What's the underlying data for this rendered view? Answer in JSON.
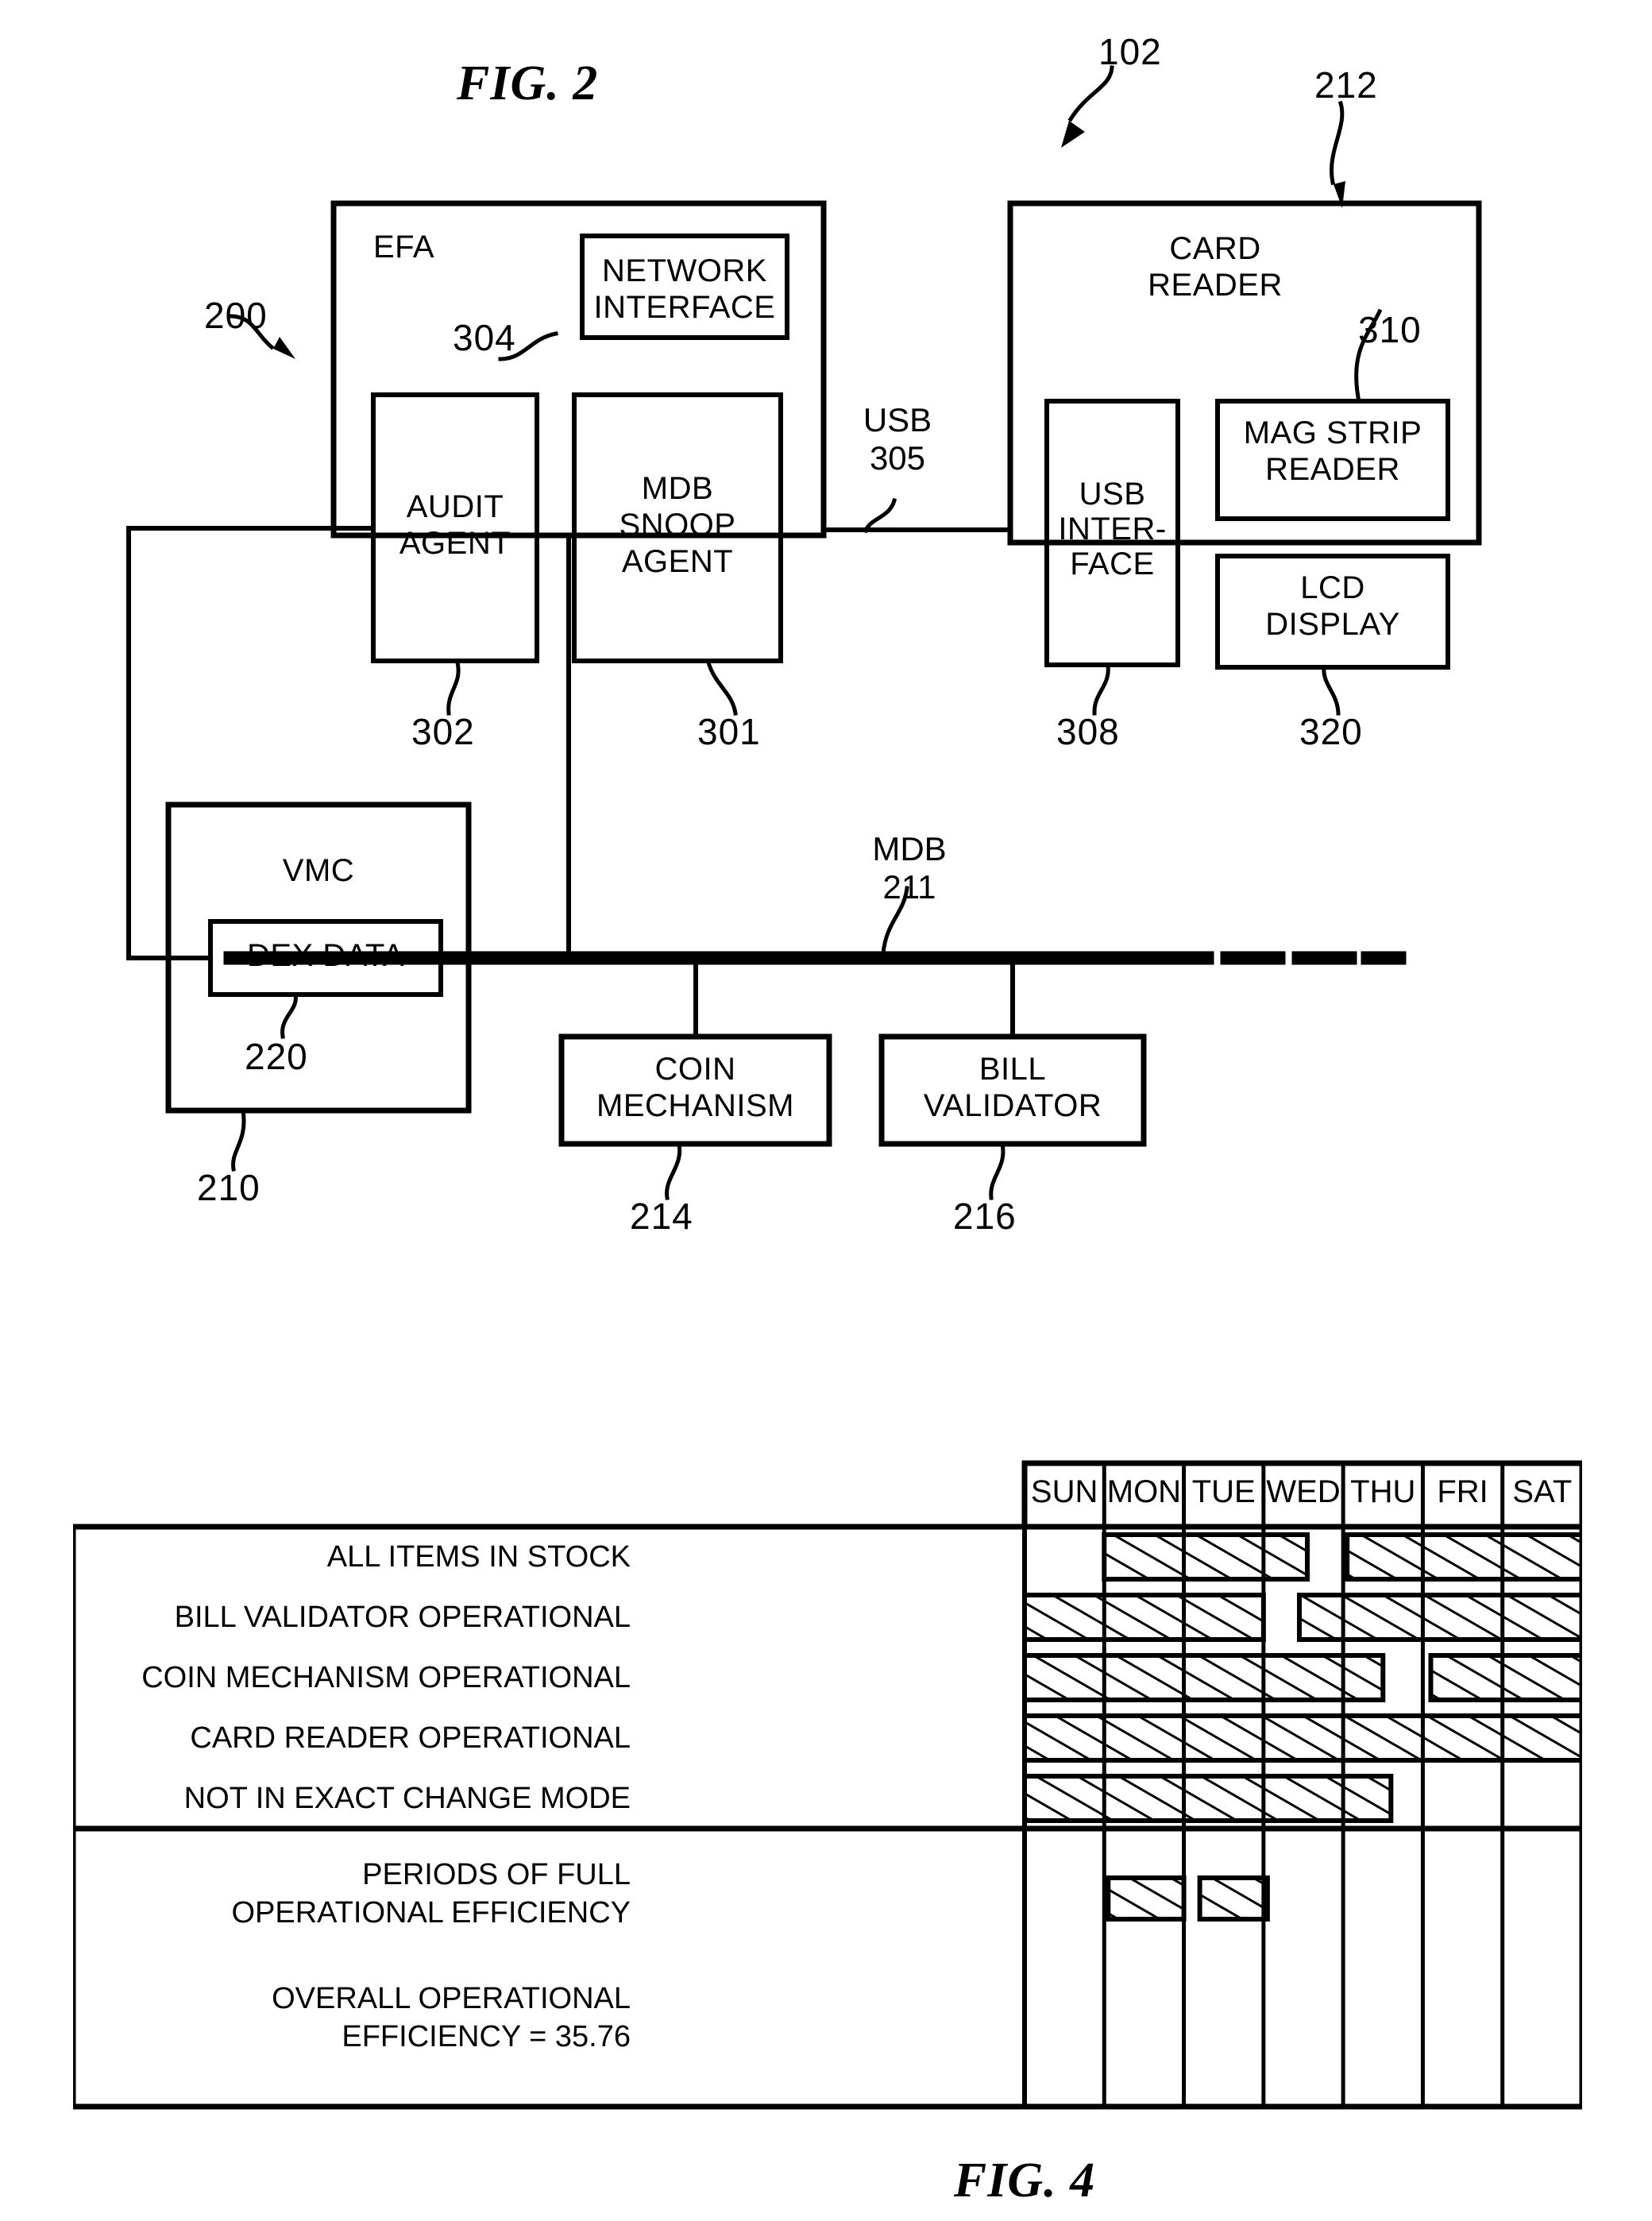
{
  "figures": {
    "fig2": {
      "title": "FIG. 2"
    },
    "fig4": {
      "title": "FIG. 4"
    }
  },
  "fig2": {
    "refs": {
      "system": "102",
      "efa_pointer": "200",
      "card_reader_pointer": "212",
      "network_interface": "304",
      "audit_agent": "302",
      "mdb_snoop_agent": "301",
      "usb_interface": "308",
      "mag_strip_reader": "310",
      "lcd_display": "320",
      "dex_data": "220",
      "vmc": "210",
      "coin_mechanism": "214",
      "bill_validator": "216",
      "mdb_bus": "211"
    },
    "blocks": {
      "efa": "EFA",
      "network_interface": "NETWORK\nINTERFACE",
      "audit_agent": "AUDIT\nAGENT",
      "mdb_snoop_agent": "MDB\nSNOOP\nAGENT",
      "card_reader": "CARD\nREADER",
      "usb_interface": "USB\nINTER-\nFACE",
      "mag_strip_reader": "MAG STRIP\nREADER",
      "lcd_display": "LCD\nDISPLAY",
      "vmc": "VMC",
      "dex_data": "DEX DATA",
      "coin_mechanism": "COIN\nMECHANISM",
      "bill_validator": "BILL\nVALIDATOR"
    },
    "connections": {
      "usb_label": "USB",
      "usb_ref": "305",
      "mdb_label": "MDB",
      "mdb_ref": "211"
    }
  },
  "chart_data": {
    "type": "table",
    "title": "FIG. 4",
    "columns": [
      "SUN",
      "MON",
      "TUE",
      "WED",
      "THU",
      "FRI",
      "SAT"
    ],
    "rows": [
      {
        "label": "ALL ITEMS IN STOCK",
        "bars": [
          [
            1.0,
            3.55
          ],
          [
            4.05,
            7.0
          ]
        ]
      },
      {
        "label": "BILL VALIDATOR OPERATIONAL",
        "bars": [
          [
            0.0,
            3.0
          ],
          [
            3.45,
            7.0
          ]
        ]
      },
      {
        "label": "COIN MECHANISM OPERATIONAL",
        "bars": [
          [
            0.0,
            4.5
          ],
          [
            5.1,
            7.0
          ]
        ]
      },
      {
        "label": "CARD READER OPERATIONAL",
        "bars": [
          [
            0.0,
            7.0
          ]
        ]
      },
      {
        "label": "NOT IN EXACT CHANGE MODE",
        "bars": [
          [
            0.0,
            4.6
          ]
        ]
      }
    ],
    "summary_rows": [
      {
        "label": "PERIODS OF FULL\nOPERATIONAL EFFICIENCY",
        "bars": [
          [
            1.05,
            2.0
          ],
          [
            2.2,
            3.05
          ]
        ]
      },
      {
        "label": "OVERALL OPERATIONAL\nEFFICIENCY = 35.76",
        "bars": []
      }
    ],
    "xlabel": "",
    "ylabel": "",
    "grid": true,
    "legend": ""
  }
}
